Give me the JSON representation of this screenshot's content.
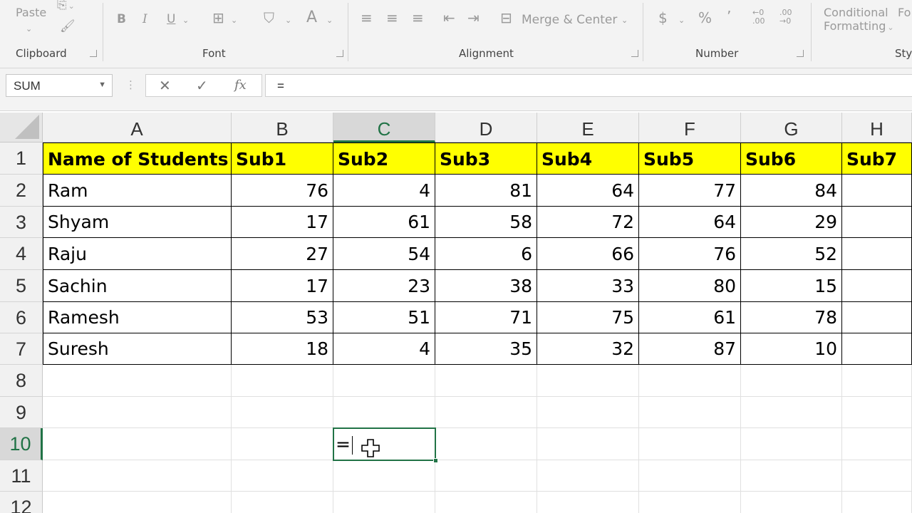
{
  "ribbon": {
    "paste": "Paste",
    "groups": {
      "clipboard": "Clipboard",
      "font": "Font",
      "alignment": "Alignment",
      "number": "Number"
    },
    "font": {
      "bold": "B",
      "italic": "I",
      "underline": "U",
      "font_color": "A"
    },
    "alignment": {
      "merge_center": "Merge & Center"
    },
    "number": {
      "currency": "$",
      "percent": "%",
      "comma": "’"
    },
    "styles": {
      "conditional_line1": "Conditional",
      "conditional_line2": "Formatting",
      "format_partial": "Fo",
      "styles_partial": "Sty"
    }
  },
  "formula_bar": {
    "name_box": "SUM",
    "formula": "="
  },
  "columns": [
    "A",
    "B",
    "C",
    "D",
    "E",
    "F",
    "G",
    "H"
  ],
  "rows": [
    "1",
    "2",
    "3",
    "4",
    "5",
    "6",
    "7",
    "8",
    "9",
    "10",
    "11",
    "12"
  ],
  "table": {
    "header": [
      "Name of Students",
      "Sub1",
      "Sub2",
      "Sub3",
      "Sub4",
      "Sub5",
      "Sub6",
      "Sub7"
    ],
    "data": [
      [
        "Ram",
        "76",
        "4",
        "81",
        "64",
        "77",
        "84"
      ],
      [
        "Shyam",
        "17",
        "61",
        "58",
        "72",
        "64",
        "29"
      ],
      [
        "Raju",
        "27",
        "54",
        "6",
        "66",
        "76",
        "52"
      ],
      [
        "Sachin",
        "17",
        "23",
        "38",
        "33",
        "80",
        "15"
      ],
      [
        "Ramesh",
        "53",
        "51",
        "71",
        "75",
        "61",
        "78"
      ],
      [
        "Suresh",
        "18",
        "4",
        "35",
        "32",
        "87",
        "10"
      ]
    ]
  },
  "active_cell": {
    "ref": "C10",
    "content": "="
  },
  "colors": {
    "header_fill": "#ffff00",
    "accent": "#217346"
  }
}
